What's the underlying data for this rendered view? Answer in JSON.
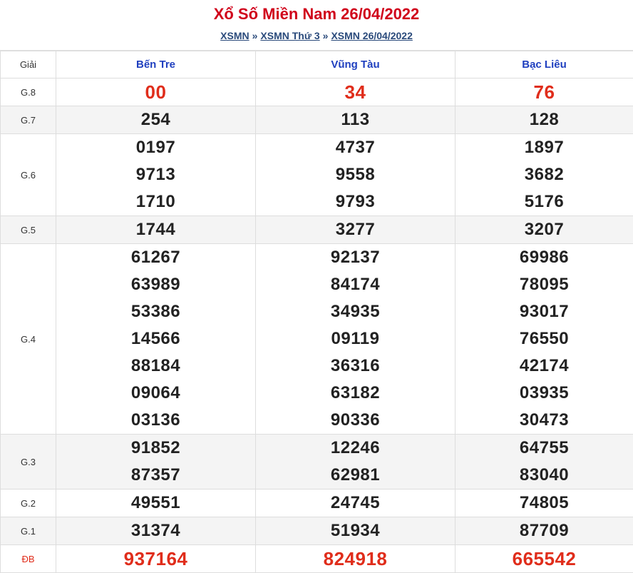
{
  "title": "Xổ Số Miền Nam 26/04/2022",
  "breadcrumb": {
    "items": [
      "XSMN",
      "XSMN Thứ 3",
      "XSMN 26/04/2022"
    ],
    "separator": "»"
  },
  "table": {
    "corner_label": "Giải",
    "provinces": [
      "Bến Tre",
      "Vũng Tàu",
      "Bạc Liêu"
    ],
    "rows": [
      {
        "label": "G.8",
        "values": [
          [
            "00"
          ],
          [
            "34"
          ],
          [
            "76"
          ]
        ]
      },
      {
        "label": "G.7",
        "values": [
          [
            "254"
          ],
          [
            "113"
          ],
          [
            "128"
          ]
        ]
      },
      {
        "label": "G.6",
        "values": [
          [
            "0197",
            "9713",
            "1710"
          ],
          [
            "4737",
            "9558",
            "9793"
          ],
          [
            "1897",
            "3682",
            "5176"
          ]
        ]
      },
      {
        "label": "G.5",
        "values": [
          [
            "1744"
          ],
          [
            "3277"
          ],
          [
            "3207"
          ]
        ]
      },
      {
        "label": "G.4",
        "values": [
          [
            "61267",
            "63989",
            "53386",
            "14566",
            "88184",
            "09064",
            "03136"
          ],
          [
            "92137",
            "84174",
            "34935",
            "09119",
            "36316",
            "63182",
            "90336"
          ],
          [
            "69986",
            "78095",
            "93017",
            "76550",
            "42174",
            "03935",
            "30473"
          ]
        ]
      },
      {
        "label": "G.3",
        "values": [
          [
            "91852",
            "87357"
          ],
          [
            "12246",
            "62981"
          ],
          [
            "64755",
            "83040"
          ]
        ]
      },
      {
        "label": "G.2",
        "values": [
          [
            "49551"
          ],
          [
            "24745"
          ],
          [
            "74805"
          ]
        ]
      },
      {
        "label": "G.1",
        "values": [
          [
            "31374"
          ],
          [
            "51934"
          ],
          [
            "87709"
          ]
        ]
      },
      {
        "label": "ĐB",
        "values": [
          [
            "937164"
          ],
          [
            "824918"
          ],
          [
            "665542"
          ]
        ]
      }
    ]
  },
  "colors": {
    "title_red": "#d0021b",
    "highlight_red": "#e02d1b",
    "province_blue": "#1f3fbf",
    "link_blue": "#2a4a7b"
  }
}
